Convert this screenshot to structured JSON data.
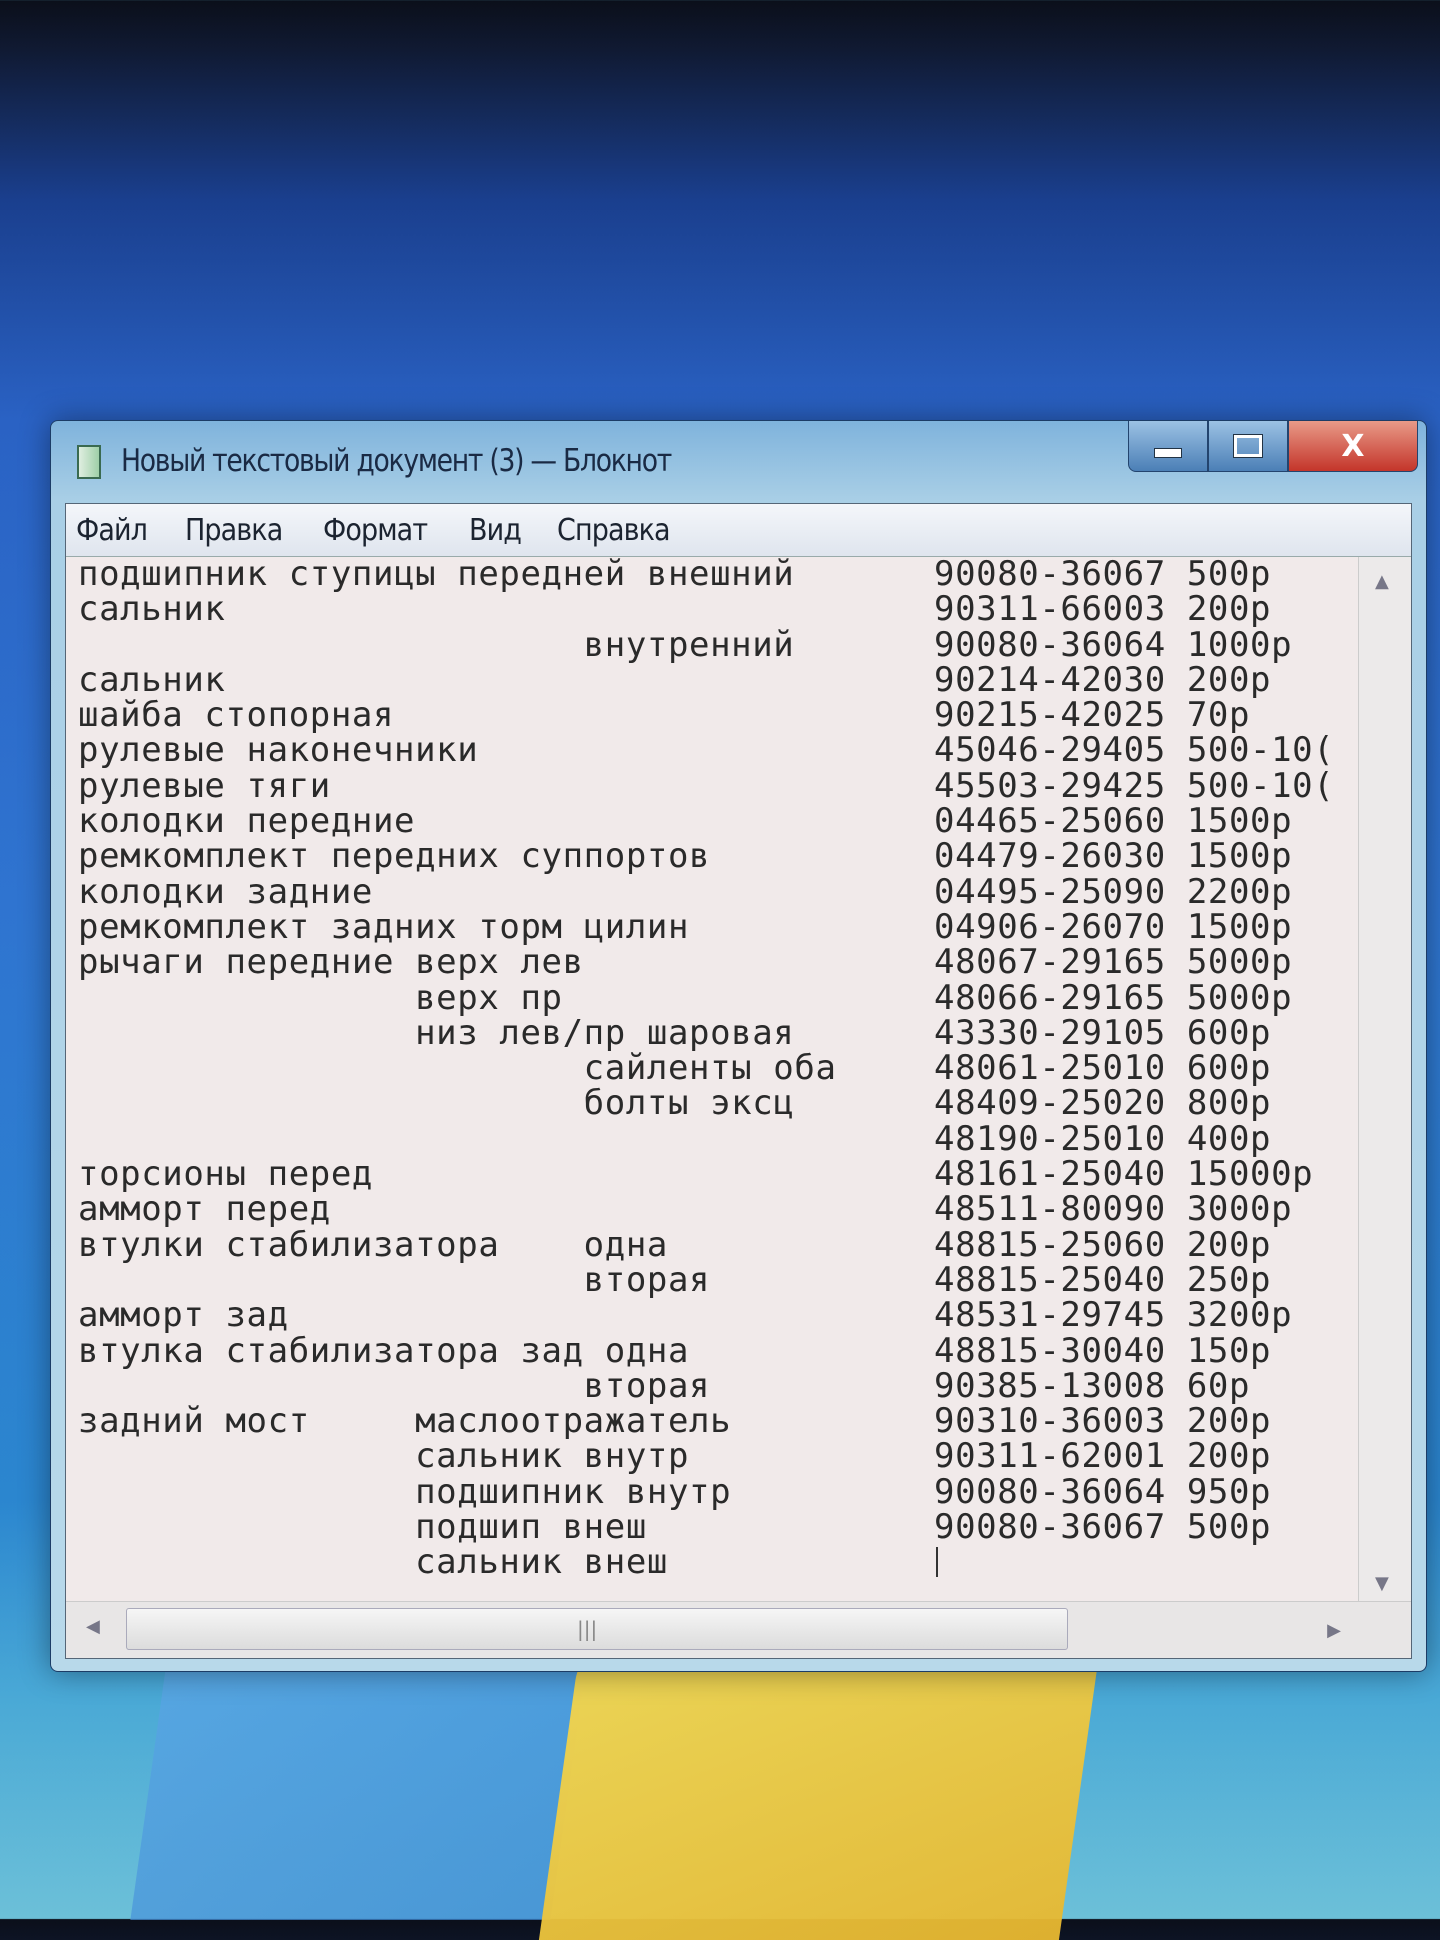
{
  "window": {
    "title": "Новый текстовый документ (3) — Блокнот",
    "controls": {
      "minimize": "minimize-icon",
      "maximize": "maximize-icon",
      "close": "X"
    }
  },
  "menu": [
    "Файл",
    "Правка",
    "Формат",
    "Вид",
    "Справка"
  ],
  "document": {
    "lines": [
      {
        "text": "подшипник ступицы передней внешний",
        "code": "90080-36067 500р"
      },
      {
        "text": "сальник",
        "code": "90311-66003 200р"
      },
      {
        "text": "                        внутренний",
        "code": "90080-36064 1000р"
      },
      {
        "text": "сальник",
        "code": "90214-42030 200р"
      },
      {
        "text": "шайба стопорная",
        "code": "90215-42025 70р"
      },
      {
        "text": "рулевые наконечники",
        "code": "45046-29405 500-10("
      },
      {
        "text": "рулевые тяги",
        "code": "45503-29425 500-10("
      },
      {
        "text": "колодки передние",
        "code": "04465-25060 1500р"
      },
      {
        "text": "ремкомплект передних суппортов",
        "code": "04479-26030 1500р"
      },
      {
        "text": "колодки задние",
        "code": "04495-25090 2200р"
      },
      {
        "text": "ремкомплект задних торм цилин",
        "code": "04906-26070 1500р"
      },
      {
        "text": "рычаги передние верх лев",
        "code": "48067-29165 5000р"
      },
      {
        "text": "                верх пр",
        "code": "48066-29165 5000р"
      },
      {
        "text": "                низ лев/пр шаровая",
        "code": "43330-29105 600р"
      },
      {
        "text": "                        сайленты оба",
        "code": "48061-25010 600р"
      },
      {
        "text": "                        болты эксц",
        "code": "48409-25020 800р"
      },
      {
        "text": "",
        "code": "48190-25010 400р"
      },
      {
        "text": "торсионы перед",
        "code": "48161-25040 15000р"
      },
      {
        "text": "амморт перед",
        "code": "48511-80090 3000р"
      },
      {
        "text": "втулки стабилизатора    одна",
        "code": "48815-25060 200р"
      },
      {
        "text": "                        вторая",
        "code": "48815-25040 250р"
      },
      {
        "text": "амморт зад",
        "code": "48531-29745 3200р"
      },
      {
        "text": "втулка стабилизатора зад одна",
        "code": "48815-30040 150р"
      },
      {
        "text": "                        вторая",
        "code": "90385-13008 60р"
      },
      {
        "text": "задний мост     маслоотражатель",
        "code": "90310-36003 200р"
      },
      {
        "text": "                сальник внутр",
        "code": "90311-62001 200р"
      },
      {
        "text": "                подшипник внутр",
        "code": "90080-36064 950р"
      },
      {
        "text": "                подшип внеш",
        "code": "90080-36067 500р"
      },
      {
        "text": "                сальник внеш",
        "code": ""
      }
    ]
  },
  "scrollbars": {
    "up": "▲",
    "down": "▼",
    "left": "◀",
    "right": "▶",
    "grip": "|||"
  }
}
